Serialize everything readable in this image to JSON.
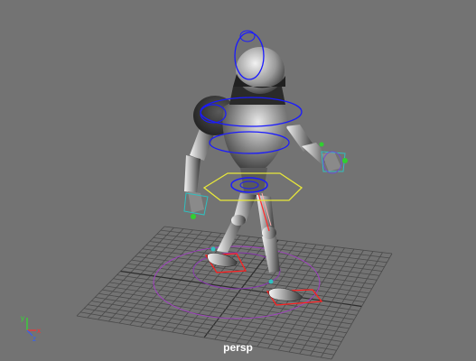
{
  "viewport": {
    "camera": "persp",
    "background_color": "#737373",
    "grid_color": "#4a4a4a",
    "grid_axis_color": "#2c2c2c"
  },
  "axis_indicator": {
    "x_label": "x",
    "y_label": "y",
    "z_label": "z",
    "x_color": "#ff3030",
    "y_color": "#30e030",
    "z_color": "#3060ff"
  },
  "controls": {
    "fk_ik_color": "#1a1aff",
    "cog_color": "#e8e83a",
    "foot_ik_color": "#ff2020",
    "pole_circle_color": "#a040c0",
    "hand_ctrl_color": "#30c0c0"
  }
}
